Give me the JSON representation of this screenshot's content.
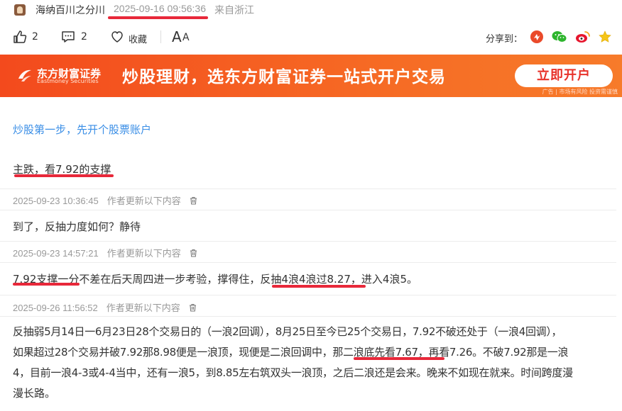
{
  "author": {
    "name": "海纳百川之分川",
    "time": "2025-09-16 09:56:36",
    "source": "来自浙江"
  },
  "actions": {
    "like_count": "2",
    "comment_count": "2",
    "favorite_label": "收藏",
    "font_label": "A",
    "font_label_small": "A",
    "share_label": "分享到："
  },
  "banner": {
    "logo_cn": "东方财富证券",
    "logo_en": "Eastmoney Securities",
    "slogan": "炒股理财，选东方财富证券一站式开户交易",
    "button": "立即开户",
    "note": "广告 | 市场有风险 投资需谨慎"
  },
  "content": {
    "account_link": "炒股第一步，先开个股票账户",
    "headline": "主跌，看7.92的支撑",
    "updates": [
      {
        "time": "2025-09-23 10:36:45",
        "label": "作者更新以下内容",
        "text": "到了，反抽力度如何？静待"
      },
      {
        "time": "2025-09-23 14:57:21",
        "label": "作者更新以下内容",
        "text_a": "7.92支撑一分",
        "text_b": "不差在后天周四进一步考验，撑得住，",
        "text_c": "反抽4浪4浪过8.27",
        "text_d": "，进入4浪5。"
      },
      {
        "time": "2025-09-26 11:56:52",
        "label": "作者更新以下内容",
        "line1": "反抽弱5月14日一6月23日28个交易日的（一浪2回调），8月25日至今已25个交易日，7.92不破还处于（一浪4回调），",
        "line2a": "如果超过28个交易并破7.92那8.98便是一浪顶，现便是二浪回调中，",
        "line2b": "那二浪底先看7.67",
        "line2c": "，再看7.26。不破7.92那是一浪",
        "line3": "4，目前一浪4-3或4-4当中，还有一浪5，到8.85左右筑双头一浪顶，之后二浪还是会来。晚来不如现在就来。时间跨度漫",
        "line4": "漫长路。"
      }
    ]
  },
  "colors": {
    "accent_red": "#e8283a",
    "link_blue": "#3a8ee6",
    "banner_orange": "#f34a1d"
  }
}
